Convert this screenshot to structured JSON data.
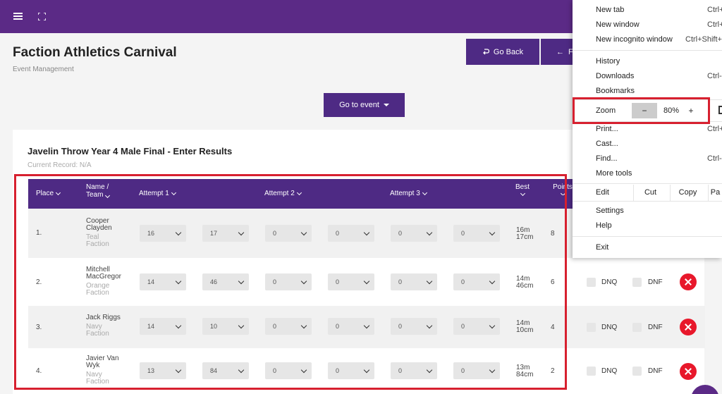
{
  "page": {
    "title": "Faction Athletics Carnival",
    "subtitle": "Event Management"
  },
  "buttons": {
    "go_back": "Go Back",
    "second": "F",
    "go_to_event": "Go to event"
  },
  "event": {
    "title": "Javelin Throw Year 4 Male Final - Enter Results",
    "record": "Current Record: N/A"
  },
  "table": {
    "headers": {
      "place": "Place",
      "name_line1": "Name /",
      "name_line2": "Team",
      "attempt1": "Attempt 1",
      "attempt2": "Attempt 2",
      "attempt3": "Attempt 3",
      "best": "Best",
      "points": "Points"
    },
    "dnq_label": "DNQ",
    "dnf_label": "DNF",
    "rows": [
      {
        "place": "1.",
        "name_line1": "Cooper",
        "name_line2": "Clayden",
        "team_line1": "Teal",
        "team_line2": "Faction",
        "a1m": "16",
        "a1cm": "17",
        "a2m": "0",
        "a2cm": "0",
        "a3m": "0",
        "a3cm": "0",
        "best_line1": "16m",
        "best_line2": "17cm",
        "points": "8"
      },
      {
        "place": "2.",
        "name_line1": "Mitchell",
        "name_line2": "MacGregor",
        "team_line1": "Orange",
        "team_line2": "Faction",
        "a1m": "14",
        "a1cm": "46",
        "a2m": "0",
        "a2cm": "0",
        "a3m": "0",
        "a3cm": "0",
        "best_line1": "14m",
        "best_line2": "46cm",
        "points": "6"
      },
      {
        "place": "3.",
        "name_line1": "Jack Riggs",
        "name_line2": "",
        "team_line1": "Navy",
        "team_line2": "Faction",
        "a1m": "14",
        "a1cm": "10",
        "a2m": "0",
        "a2cm": "0",
        "a3m": "0",
        "a3cm": "0",
        "best_line1": "14m",
        "best_line2": "10cm",
        "points": "4"
      },
      {
        "place": "4.",
        "name_line1": "Javier Van",
        "name_line2": "Wyk",
        "team_line1": "Navy",
        "team_line2": "Faction",
        "a1m": "13",
        "a1cm": "84",
        "a2m": "0",
        "a2cm": "0",
        "a3m": "0",
        "a3cm": "0",
        "best_line1": "13m",
        "best_line2": "84cm",
        "points": "2"
      }
    ]
  },
  "context_menu": {
    "new_tab": "New tab",
    "new_tab_short": "Ctrl+",
    "new_window": "New window",
    "new_window_short": "Ctrl+",
    "new_incognito": "New incognito window",
    "new_incognito_short": "Ctrl+Shift+",
    "history": "History",
    "downloads": "Downloads",
    "downloads_short": "Ctrl-",
    "bookmarks": "Bookmarks",
    "zoom": "Zoom",
    "zoom_minus": "−",
    "zoom_value": "80%",
    "zoom_plus": "+",
    "print": "Print...",
    "print_short": "Ctrl+",
    "cast": "Cast...",
    "find": "Find...",
    "find_short": "Ctrl-",
    "more_tools": "More tools",
    "edit": "Edit",
    "cut": "Cut",
    "copy": "Copy",
    "paste": "Pa",
    "settings": "Settings",
    "help": "Help",
    "exit": "Exit"
  },
  "colors": {
    "brand_purple": "#5b2a86",
    "button_purple": "#4e2a84",
    "remove_red": "#e8182b",
    "highlight_red": "#d7202f"
  }
}
